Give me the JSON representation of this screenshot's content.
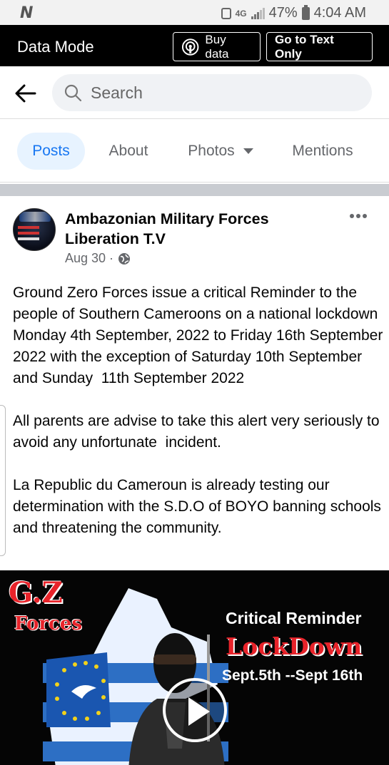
{
  "status_bar": {
    "carrier_icon": "N",
    "network": "4G",
    "battery": "47%",
    "time": "4:04 AM"
  },
  "data_bar": {
    "title": "Data Mode",
    "buy_data_label": "Buy data",
    "text_only_label": "Go to Text Only"
  },
  "search": {
    "placeholder": "Search"
  },
  "tabs": [
    {
      "label": "Posts",
      "active": true
    },
    {
      "label": "About"
    },
    {
      "label": "Photos"
    },
    {
      "label": "Mentions"
    }
  ],
  "post": {
    "author": "Ambazonian Military Forces Liberation T.V",
    "date": "Aug 30 ·",
    "paragraphs": [
      "Ground Zero Forces issue a critical Reminder to the people of Southern Cameroons on a national lockdown Monday 4th September, 2022 to Friday 16th September 2022 with the exception of Saturday 10th September  and Sunday  11th September 2022",
      "All parents are advise to take this alert very seriously to avoid any unfortunate  incident.",
      "La Republic du Cameroun is already testing our determination with the S.D.O of BOYO banning schools and threatening the community."
    ]
  },
  "video": {
    "logo_line1": "G.Z",
    "logo_line2": "Forces",
    "line1": "Critical Reminder",
    "line2": "LockDown",
    "line3": "Sept.5th --Sept 16th"
  }
}
